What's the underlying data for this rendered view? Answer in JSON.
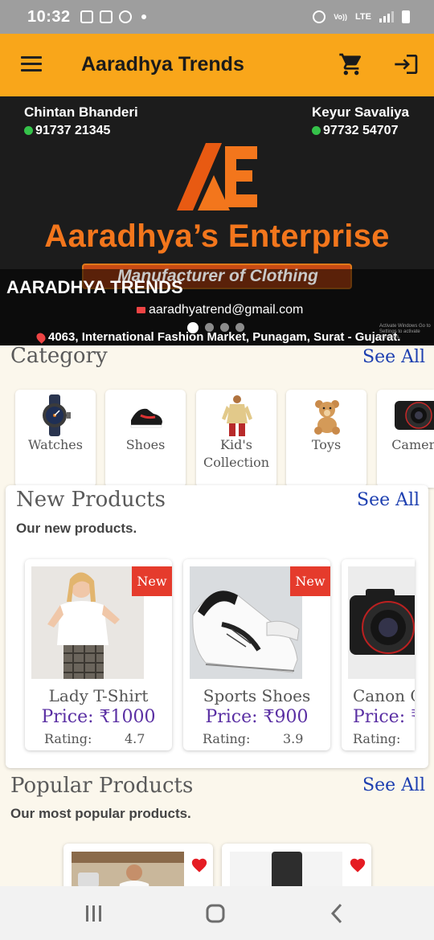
{
  "status_bar": {
    "time": "10:32",
    "network": "LTE",
    "sim": "LTE1",
    "volte": "Vo))"
  },
  "app_bar": {
    "title": "Aaradhya Trends"
  },
  "banner": {
    "left_contact": {
      "name": "Chintan Bhanderi",
      "phone": "91737 21345"
    },
    "right_contact": {
      "name": "Keyur Savaliya",
      "phone": "97732 54707"
    },
    "company_name": "Aaradhya’s  Enterprise",
    "tagline": "Manufacturer of Clothing",
    "brand": "AARADHYA TRENDS",
    "email": "aaradhyatrend@gmail.com",
    "address": "4063, International Fashion Market, Punagam, Surat - Gujarat.",
    "watermark": "Activate Windows Go to Settings to activate Windows.",
    "slides": 4,
    "active_slide": 1
  },
  "category": {
    "title": "Category",
    "see_all": "See All",
    "items": [
      {
        "label": "Watches",
        "icon": "watch-icon"
      },
      {
        "label": "Shoes",
        "icon": "shoe-icon"
      },
      {
        "label": "Kid's Collection",
        "icon": "kids-clothing-icon"
      },
      {
        "label": "Toys",
        "icon": "teddy-bear-icon"
      },
      {
        "label": "Camera",
        "icon": "camera-icon"
      }
    ]
  },
  "new_products": {
    "title": "New Products",
    "see_all": "See All",
    "subtitle": "Our new products.",
    "badge": "New",
    "rating_label": "Rating:",
    "items": [
      {
        "name": "Lady T-Shirt",
        "price": "Price: ₹1000",
        "rating": "4.7",
        "badge": true
      },
      {
        "name": "Sports Shoes",
        "price": "Price: ₹900",
        "rating": "3.9",
        "badge": true
      },
      {
        "name": "Canon Camera",
        "price": "Price: ₹",
        "rating": "",
        "badge": false
      }
    ]
  },
  "popular_products": {
    "title": "Popular Products",
    "see_all": "See All",
    "subtitle": "Our most popular products."
  },
  "colors": {
    "accent": "#f9a61a",
    "link": "#1d3fb0",
    "price": "#5a2fa3",
    "badge": "#e53b2c"
  }
}
